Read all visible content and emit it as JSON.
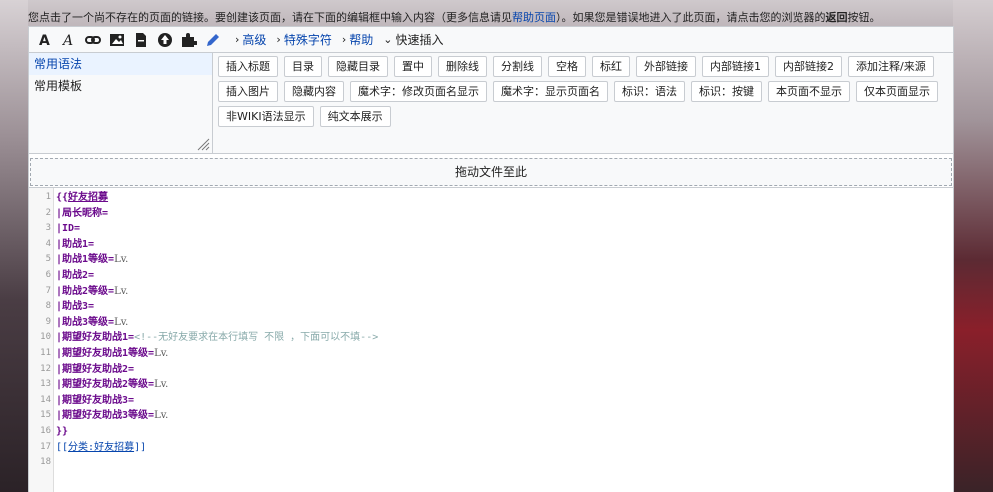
{
  "notice": {
    "prefix": "您点击了一个尚不存在的页面的链接。要创建该页面，请在下面的编辑框中输入内容（更多信息请见",
    "link": "帮助页面",
    "middle": "）。如果您是错误地进入了此页面，请点击您的浏览器的",
    "bold": "返回",
    "suffix": "按钮。"
  },
  "toolbar": {
    "icons": [
      "bold-icon",
      "italic-icon",
      "link-icon",
      "image-icon",
      "file-icon",
      "upload-icon",
      "puzzle-icon",
      "pencil-icon"
    ],
    "advanced": "高级",
    "special_chars": "特殊字符",
    "help": "帮助",
    "quick_insert": "快速插入"
  },
  "panel": {
    "side_items": [
      "常用语法",
      "常用模板"
    ],
    "buttons": [
      "插入标题",
      "目录",
      "隐藏目录",
      "置中",
      "删除线",
      "分割线",
      "空格",
      "标红",
      "外部链接",
      "内部链接1",
      "内部链接2",
      "添加注释/来源",
      "插入图片",
      "隐藏内容",
      "魔术字：修改页面名显示",
      "魔术字：显示页面名",
      "标识：语法",
      "标识：按键",
      "本页面不显示",
      "仅本页面显示",
      "非WIKI语法显示",
      "纯文本展示"
    ]
  },
  "dropzone": "拖动文件至此",
  "code_lines": [
    {
      "n": "1",
      "parts": [
        {
          "t": "{{",
          "c": ""
        },
        {
          "t": "好友招募",
          "c": "u"
        }
      ]
    },
    {
      "n": "2",
      "parts": [
        {
          "t": "|局长昵称=",
          "c": ""
        }
      ]
    },
    {
      "n": "3",
      "parts": [
        {
          "t": "|ID=",
          "c": ""
        }
      ]
    },
    {
      "n": "4",
      "parts": [
        {
          "t": "|助战1=",
          "c": ""
        }
      ]
    },
    {
      "n": "5",
      "parts": [
        {
          "t": "|助战1等级=",
          "c": ""
        },
        {
          "t": "Lv.",
          "c": "v"
        }
      ]
    },
    {
      "n": "6",
      "parts": [
        {
          "t": "|助战2=",
          "c": ""
        }
      ]
    },
    {
      "n": "7",
      "parts": [
        {
          "t": "|助战2等级=",
          "c": ""
        },
        {
          "t": "Lv.",
          "c": "v"
        }
      ]
    },
    {
      "n": "8",
      "parts": [
        {
          "t": "|助战3=",
          "c": ""
        }
      ]
    },
    {
      "n": "9",
      "parts": [
        {
          "t": "|助战3等级=",
          "c": ""
        },
        {
          "t": "Lv.",
          "c": "v"
        }
      ]
    },
    {
      "n": "10",
      "parts": [
        {
          "t": "|期望好友助战1=",
          "c": ""
        },
        {
          "t": "<!--无好友要求在本行填写 不限 ，下面可以不填-->",
          "c": "cm"
        }
      ]
    },
    {
      "n": "11",
      "parts": [
        {
          "t": "|期望好友助战1等级=",
          "c": ""
        },
        {
          "t": "Lv.",
          "c": "v"
        }
      ]
    },
    {
      "n": "12",
      "parts": [
        {
          "t": "|期望好友助战2=",
          "c": ""
        }
      ]
    },
    {
      "n": "13",
      "parts": [
        {
          "t": "|期望好友助战2等级=",
          "c": ""
        },
        {
          "t": "Lv.",
          "c": "v"
        }
      ]
    },
    {
      "n": "14",
      "parts": [
        {
          "t": "|期望好友助战3=",
          "c": ""
        }
      ]
    },
    {
      "n": "15",
      "parts": [
        {
          "t": "|期望好友助战3等级=",
          "c": ""
        },
        {
          "t": "Lv.",
          "c": "v"
        }
      ]
    },
    {
      "n": "16",
      "parts": [
        {
          "t": "}}",
          "c": ""
        }
      ]
    },
    {
      "n": "17",
      "cat": true,
      "parts": [
        {
          "t": "[[",
          "c": ""
        },
        {
          "t": "分类:好友招募",
          "c": "u"
        },
        {
          "t": "]]",
          "c": ""
        }
      ]
    },
    {
      "n": "18",
      "parts": []
    }
  ]
}
